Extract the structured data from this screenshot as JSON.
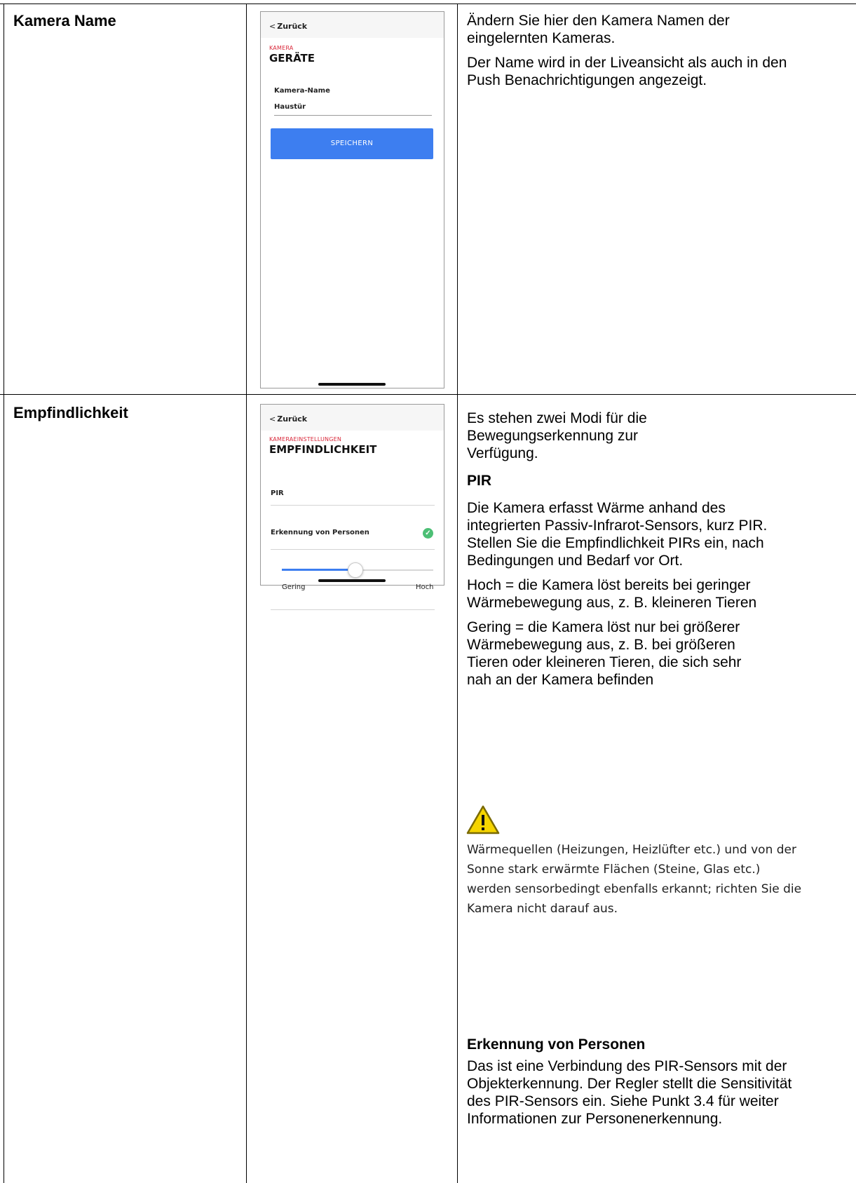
{
  "rows": [
    {
      "label": "Kamera Name",
      "phone": {
        "back": "Zurück",
        "category": "KAMERA",
        "title": "GERÄTE",
        "field_label": "Kamera-Name",
        "field_value": "Haustür",
        "button": "SPEICHERN"
      },
      "paragraphs": [
        "Ändern Sie hier den Kamera Namen der eingelernten Kameras.",
        "Der Name wird in der Liveansicht als auch in den Push Benachrichtigungen angezeigt."
      ]
    },
    {
      "label": "Empfindlichkeit",
      "phone": {
        "back": "Zurück",
        "category": "KAMERAEINSTELLUNGEN",
        "title": "EMPFINDLICHKEIT",
        "option_pir": "PIR",
        "option_person": "Erkennung von Personen",
        "option_person_checked": true,
        "slider_min": "Gering",
        "slider_max": "Hoch",
        "slider_value": 0.48
      },
      "intro": "Es stehen zwei Modi für die Bewegungserkennung zur Verfügung.",
      "pir_heading": "PIR",
      "pir_text": "Die Kamera erfasst Wärme anhand des integrierten Passiv-Infrarot-Sensors, kurz PIR. Stellen Sie die Empfindlichkeit PIRs ein, nach Bedingungen und Bedarf vor Ort.",
      "high_text": "Hoch = die Kamera löst bereits bei geringer Wärmebewegung aus, z. B. kleineren Tieren",
      "low_text": "Gering = die Kamera löst nur bei größerer Wärmebewegung aus, z. B. bei größeren Tieren oder kleineren Tieren, die sich sehr nah an der Kamera befinden",
      "warning_icon": "warning-triangle-icon",
      "warning_text": "Wärmequellen (Heizungen, Heizlüfter etc.) und von der Sonne stark erwärmte Flächen (Steine, Glas etc.) werden sensorbedingt ebenfalls erkannt; richten Sie die Kamera nicht darauf aus.",
      "person_heading": "Erkennung von Personen",
      "person_text": "Das ist eine Verbindung des PIR-Sensors mit der Objekterkennung. Der Regler stellt die Sensitivität des PIR-Sensors ein. Siehe Punkt 3.4 für weiter Informationen zur Personenerkennung."
    }
  ],
  "colors": {
    "accent_red": "#d9283a",
    "button_blue": "#3d7ef0",
    "check_green": "#4cbf75",
    "warning_yellow": "#f5d400"
  }
}
